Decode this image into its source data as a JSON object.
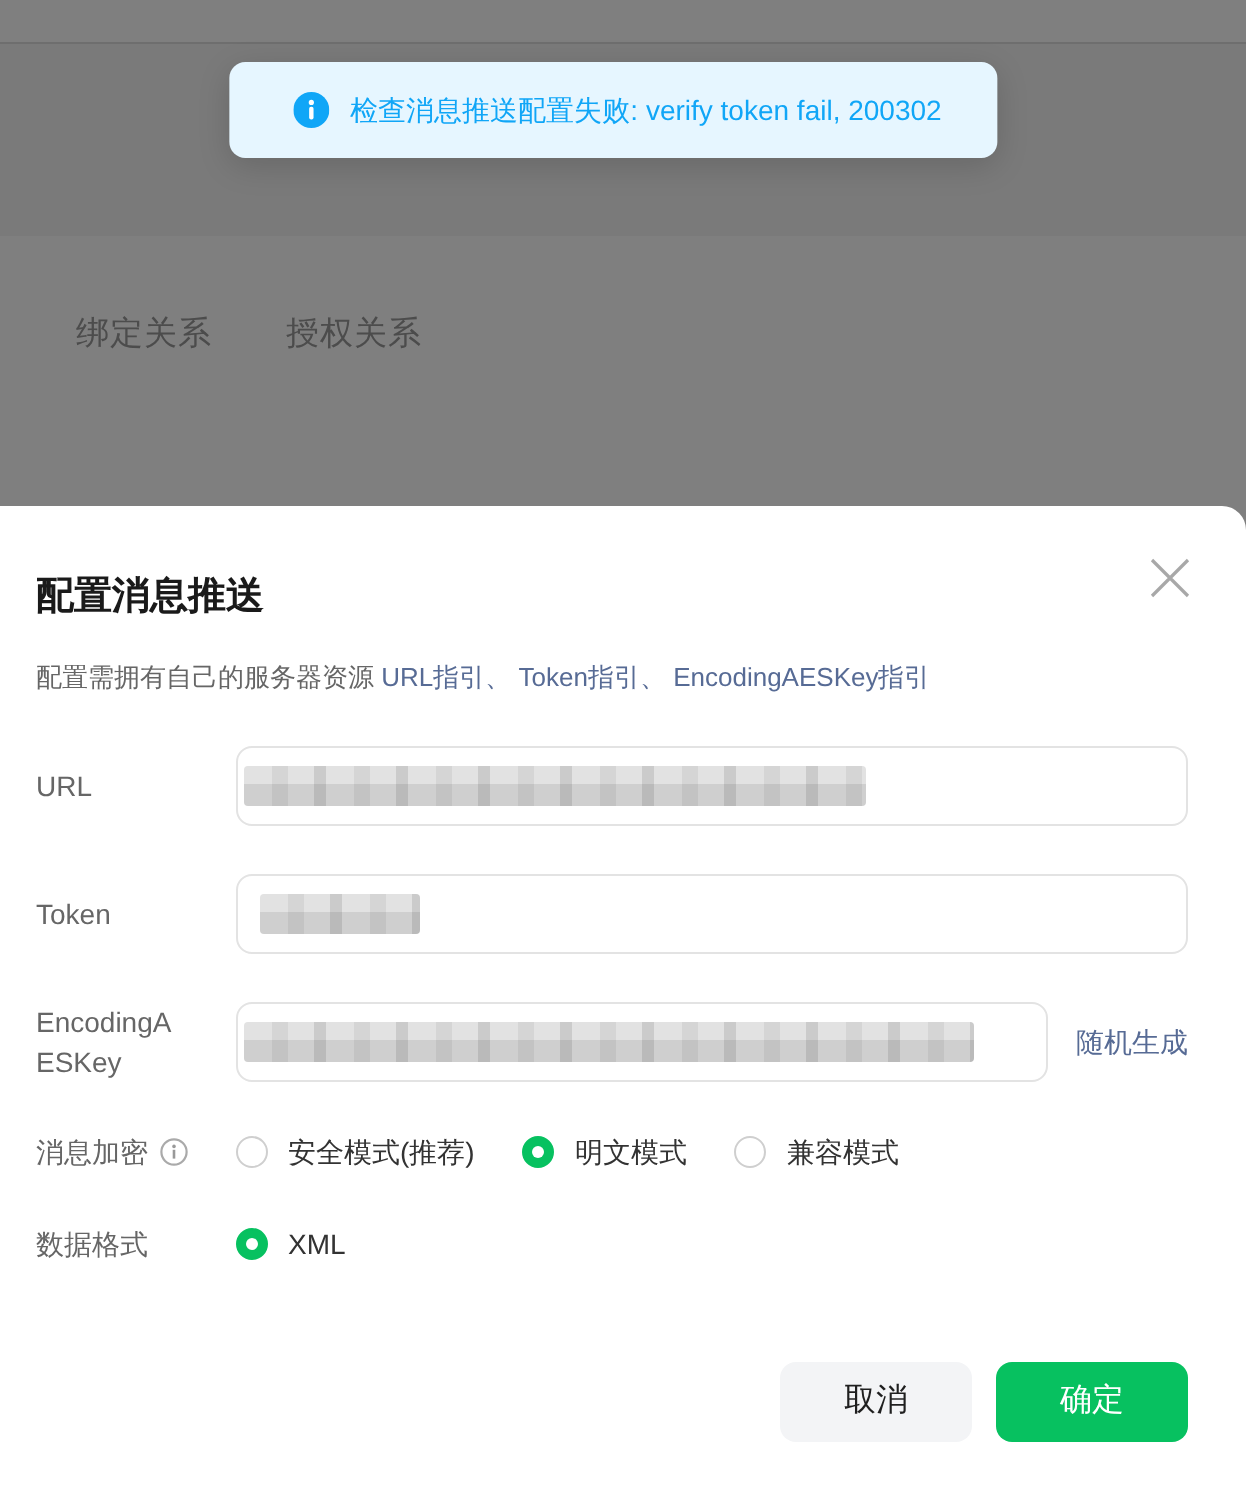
{
  "background": {
    "tabs": [
      {
        "label": "绑定关系",
        "selected": false
      },
      {
        "label": "授权关系",
        "selected": false
      }
    ]
  },
  "toast": {
    "kind": "info",
    "text": "检查消息推送配置失败: verify token fail, 200302"
  },
  "dialog": {
    "title": "配置消息推送",
    "description": "配置需拥有自己的服务器资源",
    "guide_links": [
      "URL指引、",
      "Token指引、",
      "EncodingAESKey指引"
    ],
    "fields": [
      {
        "label": "URL",
        "value_redacted": true
      },
      {
        "label": "Token",
        "value_redacted": true
      },
      {
        "label": "EncodingAESKey",
        "value_redacted": true,
        "action": "随机生成"
      }
    ],
    "encryption": {
      "label": "消息加密",
      "options": [
        {
          "label": "安全模式(推荐)",
          "selected": false
        },
        {
          "label": "明文模式",
          "selected": true
        },
        {
          "label": "兼容模式",
          "selected": false
        }
      ]
    },
    "data_format": {
      "label": "数据格式",
      "options": [
        {
          "label": "XML",
          "selected": true
        }
      ]
    },
    "buttons": [
      {
        "label": "取消",
        "kind": "secondary"
      },
      {
        "label": "确定",
        "kind": "primary"
      }
    ]
  }
}
